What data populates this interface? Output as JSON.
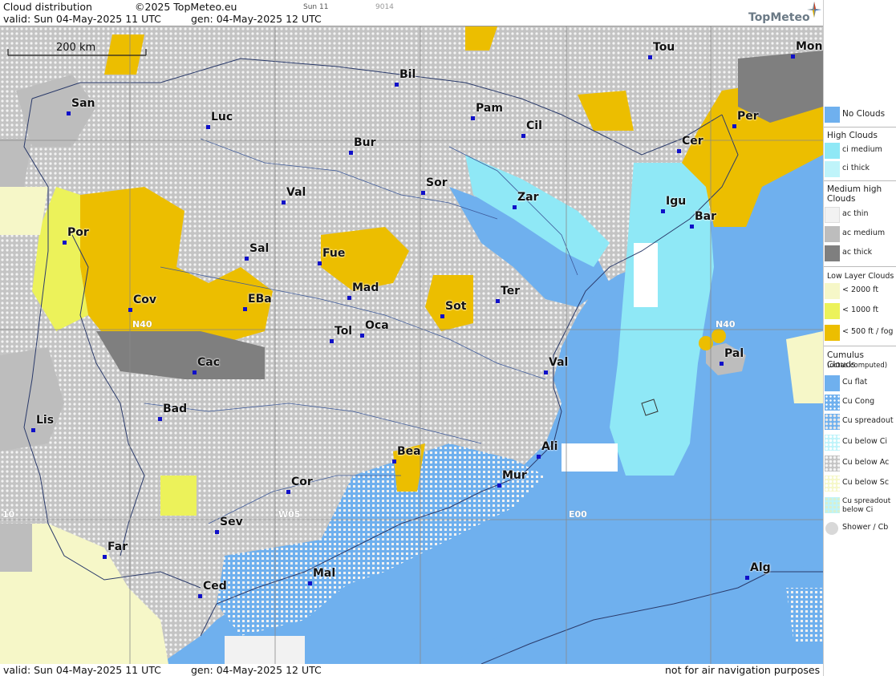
{
  "header": {
    "title": "Cloud distribution",
    "copyright": "©2025 TopMeteo.eu",
    "small_day": "Sun 11",
    "small_code": "9014",
    "valid": "valid:  Sun  04-May-2025  11 UTC",
    "gen": "gen: 04-May-2025 12 UTC",
    "logo": "TopMeteo"
  },
  "footer": {
    "valid": "valid:  Sun  04-May-2025  11 UTC",
    "gen": "gen: 04-May-2025 12 UTC",
    "disclaimer": "not for air navigation purposes"
  },
  "map": {
    "scale_label": "200 km",
    "grid_labels": {
      "n40_left": "N40",
      "n40_right": "N40",
      "w05": "W05",
      "e00": "E00",
      "w10": "10"
    },
    "cities": [
      {
        "name": "Tou"
      },
      {
        "name": "Mon"
      },
      {
        "name": "Bil"
      },
      {
        "name": "San"
      },
      {
        "name": "Pam"
      },
      {
        "name": "Luc"
      },
      {
        "name": "Cil"
      },
      {
        "name": "Per"
      },
      {
        "name": "Cer"
      },
      {
        "name": "Bur"
      },
      {
        "name": "Sor"
      },
      {
        "name": "Zar"
      },
      {
        "name": "Val"
      },
      {
        "name": "Igu"
      },
      {
        "name": "Bar"
      },
      {
        "name": "Por"
      },
      {
        "name": "Sal"
      },
      {
        "name": "Fue"
      },
      {
        "name": "Mad"
      },
      {
        "name": "Ter"
      },
      {
        "name": "Cov"
      },
      {
        "name": "EBa"
      },
      {
        "name": "Sot"
      },
      {
        "name": "Tol"
      },
      {
        "name": "Oca"
      },
      {
        "name": "Pal"
      },
      {
        "name": "Cac"
      },
      {
        "name": "Val"
      },
      {
        "name": "Lis"
      },
      {
        "name": "Bad"
      },
      {
        "name": "Bea"
      },
      {
        "name": "Ali"
      },
      {
        "name": "Mur"
      },
      {
        "name": "Cor"
      },
      {
        "name": "Sev"
      },
      {
        "name": "Far"
      },
      {
        "name": "Mal"
      },
      {
        "name": "Alg"
      },
      {
        "name": "Ced"
      }
    ]
  },
  "legend": {
    "no_clouds": "No Clouds",
    "high_clouds": "High Clouds",
    "ci_medium": "ci medium",
    "ci_thick": "ci thick",
    "medium_high": "Medium high Clouds",
    "ac_thin": "ac thin",
    "ac_medium": "ac medium",
    "ac_thick": "ac thick",
    "low_layer": "Low Layer Clouds",
    "lt2000": "< 2000 ft",
    "lt1000": "< 1000 ft",
    "lt500": "< 500 ft / fog",
    "cumulus": "Cumulus Clouds",
    "octas": "(octas computed)",
    "cu_flat": "Cu flat",
    "cu_cong": "Cu Cong",
    "cu_spreadout": "Cu spreadout",
    "cu_below_ci": "Cu below Ci",
    "cu_below_ac": "Cu below Ac",
    "cu_below_sc": "Cu below Sc",
    "cu_spreadout_below_ci": "Cu spreadout below Ci",
    "shower": "Shower / Cb"
  },
  "colors": {
    "sea_no_clouds": "#6fb0ee",
    "ci_medium": "#8fe8f6",
    "ci_thick": "#bff4fa",
    "ac_thin": "#f2f2f2",
    "ac_medium": "#bdbdbd",
    "ac_thick": "#7f7f7f",
    "lt2000": "#f6f7c8",
    "lt1000": "#ecf25a",
    "lt500": "#ecbe00",
    "city_dot": "#1010c8"
  }
}
